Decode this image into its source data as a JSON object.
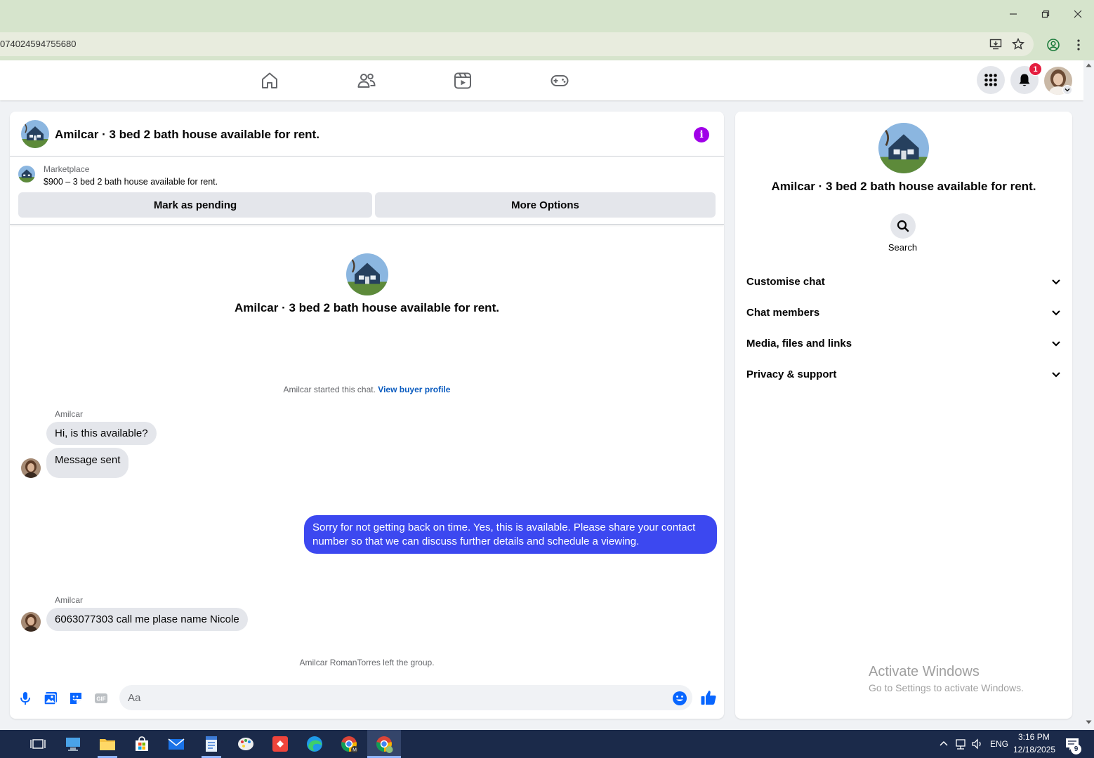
{
  "browser": {
    "url": "074024594755680"
  },
  "nav": {
    "notifications_count": "1"
  },
  "chat": {
    "title": "Amilcar · 3 bed 2 bath house available for rent.",
    "marketplace_label": "Marketplace",
    "listing": "$900 – 3 bed 2 bath house available for rent.",
    "mark_pending_label": "Mark as pending",
    "more_options_label": "More Options",
    "intro_name": "Amilcar · 3 bed 2 bath house available for rent.",
    "started_text": "Amilcar started this chat.",
    "view_buyer_profile": "View buyer profile",
    "messages": [
      {
        "sender": "Amilcar",
        "text": "Hi, is this available?"
      },
      {
        "text": "Message sent"
      },
      {
        "text": "Sorry for not getting back on time. Yes, this is available. Please share your contact number so that we can discuss further details and schedule a viewing."
      },
      {
        "sender": "Amilcar",
        "text": "6063077303 call me plase name Nicole"
      }
    ],
    "left_group_text": "Amilcar RomanTorres left the group.",
    "composer_placeholder": "Aa"
  },
  "info_panel": {
    "name": "Amilcar · 3 bed 2 bath house available for rent.",
    "search_label": "Search",
    "sections": [
      "Customise chat",
      "Chat members",
      "Media, files and links",
      "Privacy & support"
    ]
  },
  "watermark": {
    "line1": "Activate Windows",
    "line2": "Go to Settings to activate Windows."
  },
  "taskbar": {
    "lang": "ENG",
    "time": "3:16 PM",
    "date": "12/18/2025",
    "action_center_count": "9"
  },
  "colors": {
    "accent_blue": "#3c48f0",
    "info_purple": "#a000e8",
    "badge_red": "#e41e3f",
    "chrome_green": "#d6e4cc"
  }
}
